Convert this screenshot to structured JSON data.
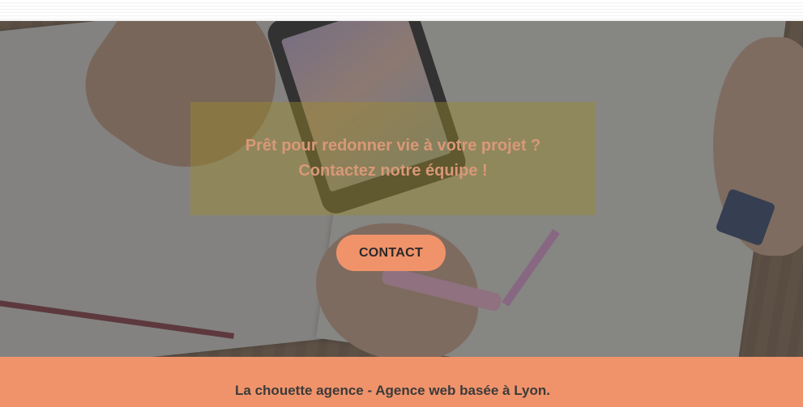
{
  "hero": {
    "message_line1": "Prêt pour redonner vie à votre projet ?",
    "message_line2": "Contactez notre équipe !",
    "cta_label": "CONTACT"
  },
  "footer": {
    "text": "La chouette agence - Agence web basée à Lyon."
  },
  "colors": {
    "accent": "#f0936a",
    "message_text": "#d99877",
    "overlay_box": "#a08c28"
  }
}
